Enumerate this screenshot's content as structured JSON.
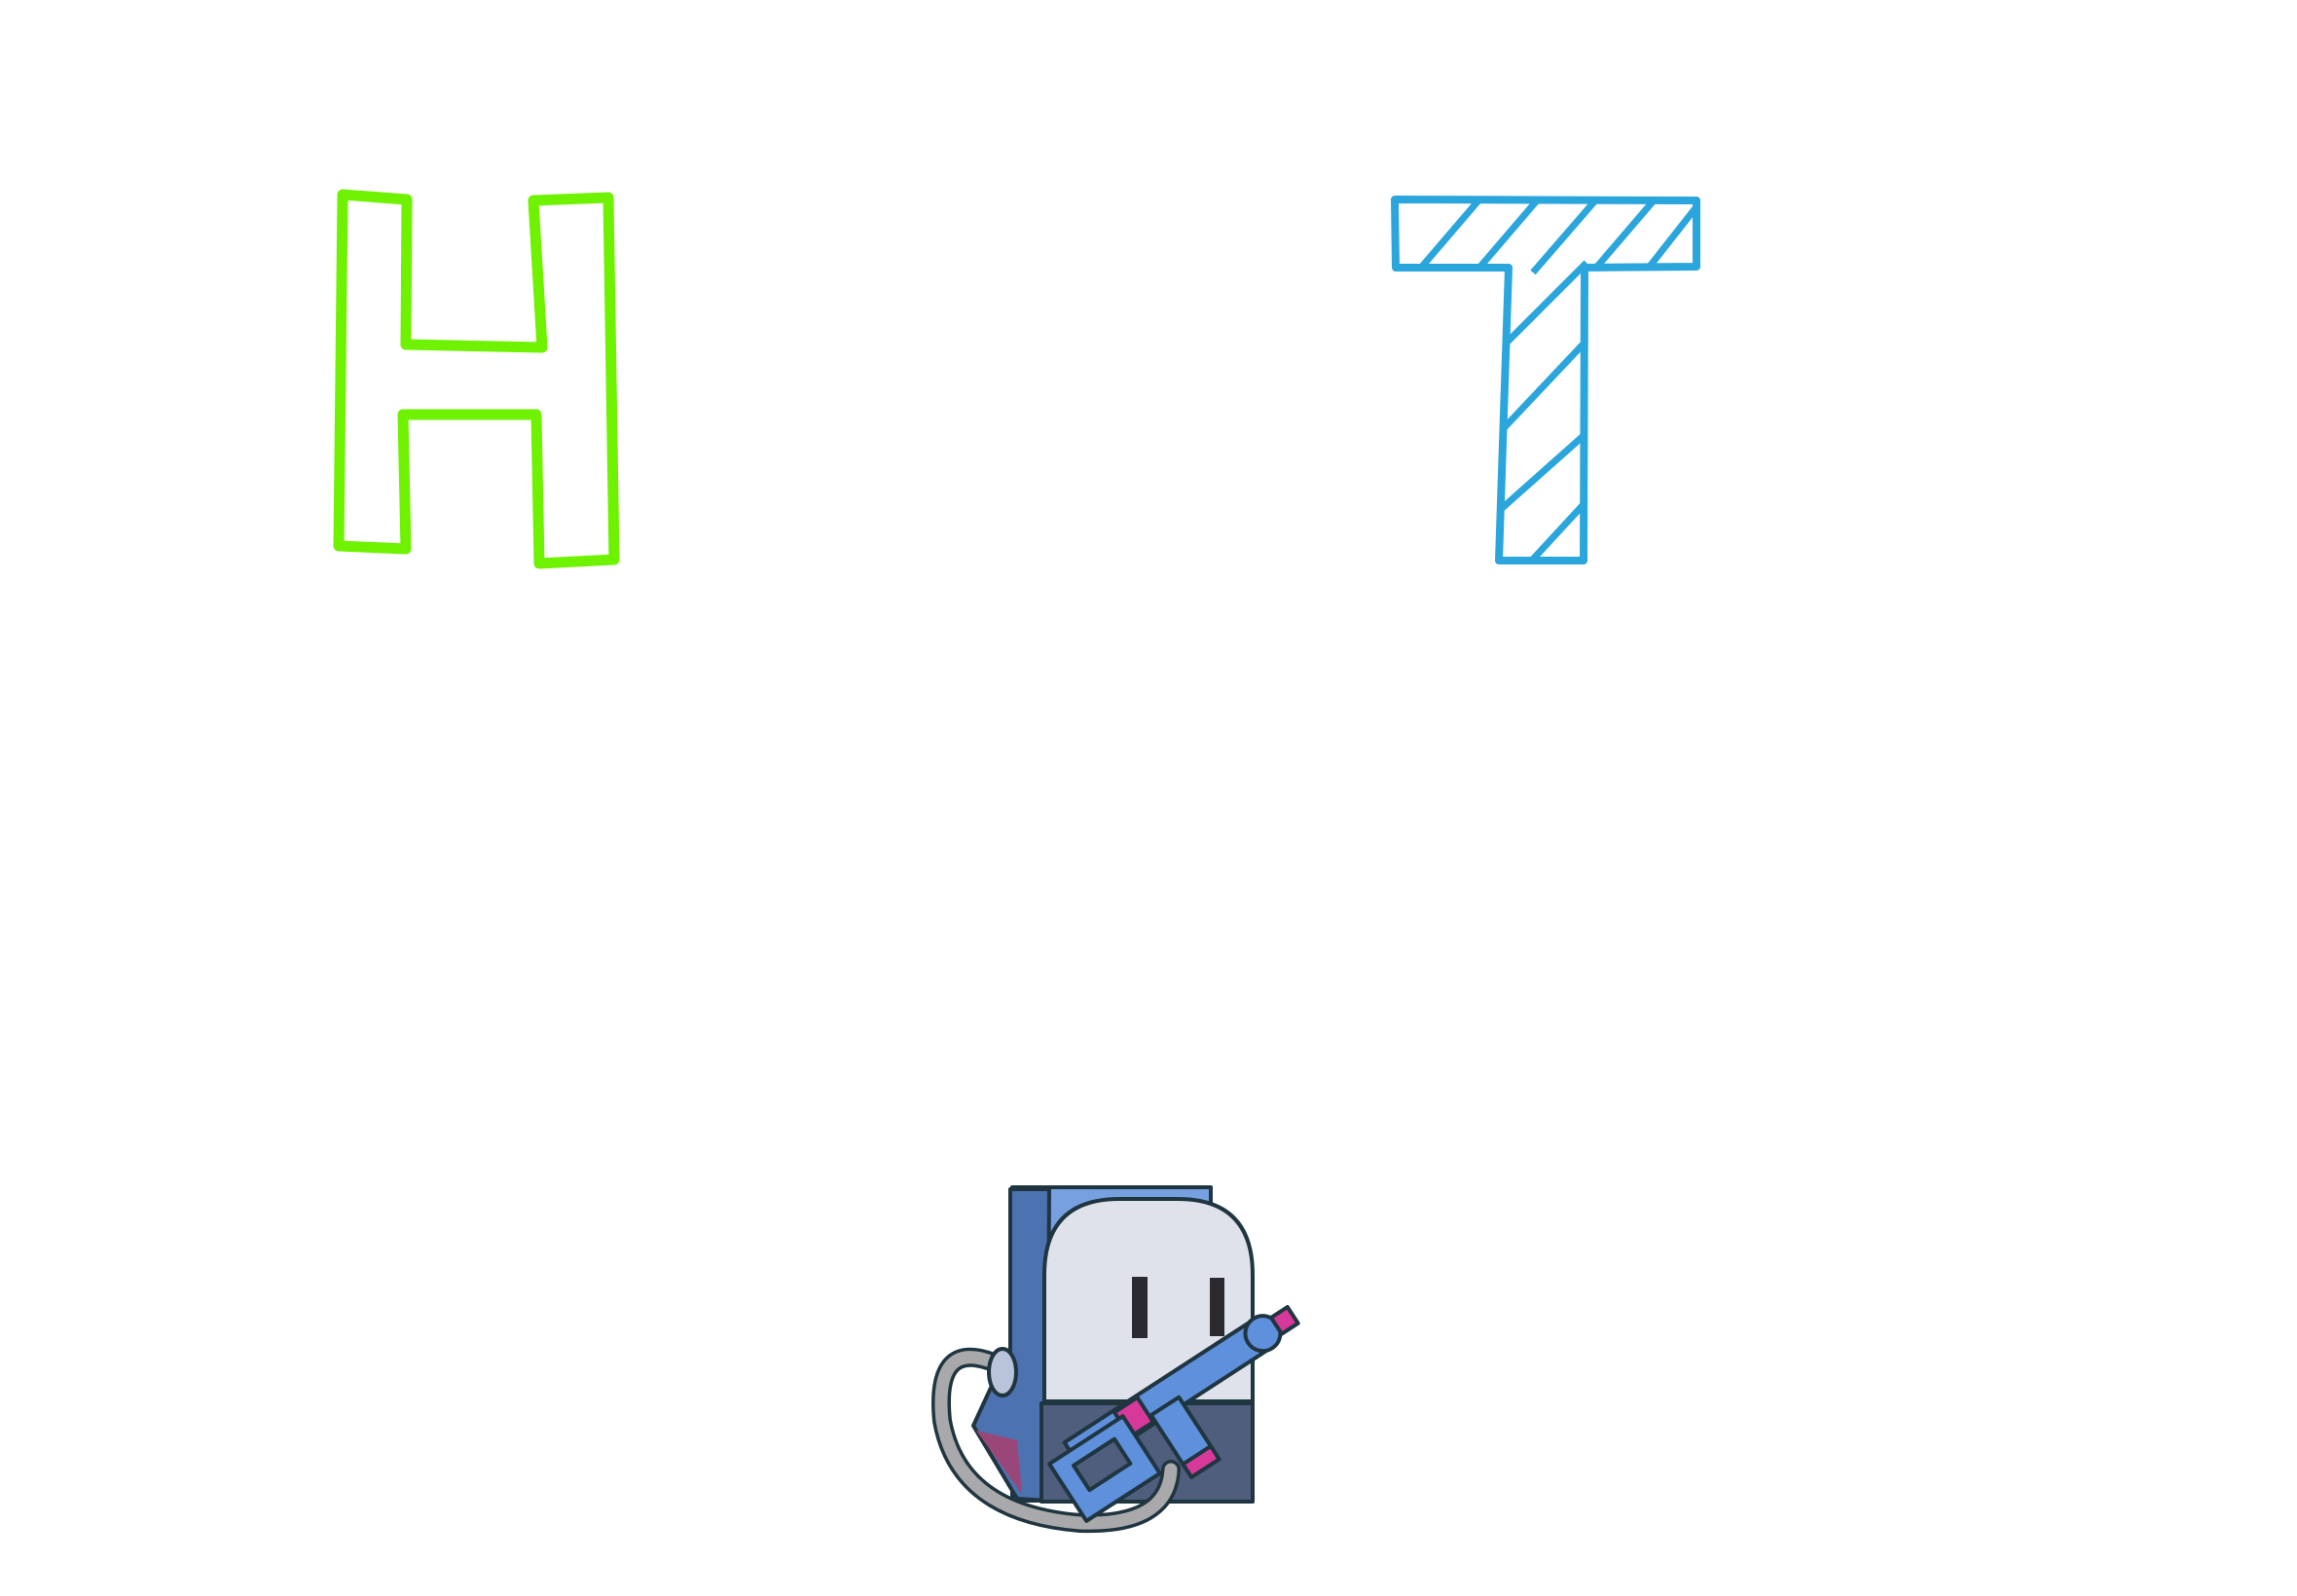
{
  "canvas": {
    "background": "#ffffff"
  },
  "letters": [
    {
      "char": "H",
      "style": "outline",
      "color": "#6ef200"
    },
    {
      "char": "T",
      "style": "hatched-outline",
      "color": "#2ba6dd"
    }
  ],
  "character": {
    "icon": "robot-mascot-with-blaster",
    "colors": {
      "body_blue": "#4d72b0",
      "back_light": "#76a0e0",
      "face": "#dfe2ea",
      "lower_body": "#4f5e7c",
      "eyes": "#2a2a30",
      "accent_pink": "#d6399a",
      "gun_blue": "#5f90dc",
      "hose_gray": "#a9a9ab",
      "outline": "#1f3540"
    }
  }
}
